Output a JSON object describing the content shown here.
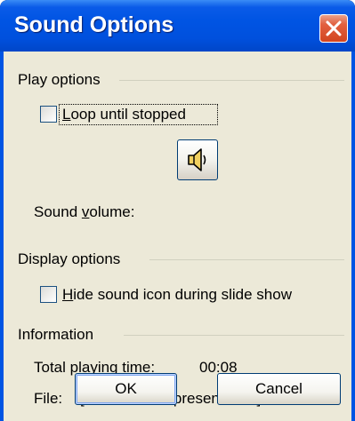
{
  "window": {
    "title": "Sound Options"
  },
  "play_options": {
    "group_label": "Play options",
    "loop_checkbox": {
      "label_accel": "L",
      "label_rest": "oop until stopped",
      "checked": false
    },
    "sound_volume": {
      "label_pre": "Sound ",
      "label_accel": "v",
      "label_rest": "olume:"
    }
  },
  "display_options": {
    "group_label": "Display options",
    "hide_checkbox": {
      "label_accel": "H",
      "label_rest": "ide sound icon during slide show",
      "checked": false
    }
  },
  "information": {
    "group_label": "Information",
    "playing_time_label": "Total playing time:",
    "playing_time_value": "00:08",
    "file_label": "File:",
    "file_value": "[Contained in presentation]"
  },
  "buttons": {
    "ok": "OK",
    "cancel": "Cancel"
  },
  "icons": {
    "close": "close-icon",
    "speaker": "speaker-icon"
  },
  "colors": {
    "titlebar": "#0054e3",
    "dialog_bg": "#ece9d8",
    "close_button": "#e2603f"
  }
}
